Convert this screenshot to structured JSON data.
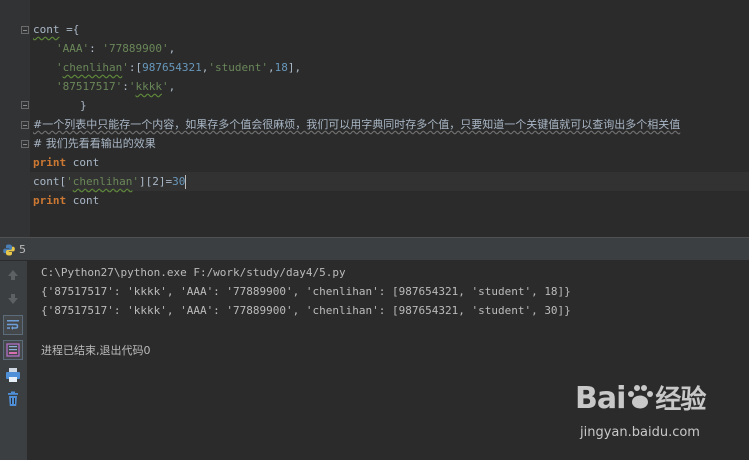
{
  "editor": {
    "lines": [
      {
        "t1": "cont",
        "t2": " ={"
      },
      {
        "s1": "'AAA'",
        "p1": ": ",
        "s2": "'77889900'",
        "p2": ","
      },
      {
        "s1": "'",
        "w1": "chenlihan",
        "s1b": "'",
        "p1": ":[",
        "n1": "987654321",
        "p2": ",",
        "s2": "'student'",
        "p3": ",",
        "n2": "18",
        "p4": "],"
      },
      {
        "s1": "'87517517'",
        "p1": ":",
        "s2": "'",
        "w2": "kkkk",
        "s2b": "'",
        "p2": ","
      },
      {
        "t": "}"
      },
      {
        "c": "#一个列表中只能存一个内容，如果存多个值会很麻烦，我们可以用字典同时存多个值，只要知道一个关键值就可以查询出多个相关值"
      },
      {
        "c": "# 我们先看看输出的效果"
      },
      {
        "kw": "print",
        "rest": " cont"
      },
      {
        "a": "cont[",
        "s1": "'",
        "w": "chenlihan",
        "s1b": "'",
        "b": "][2]=",
        "n": "30"
      },
      {
        "kw": "print",
        "rest": " cont"
      }
    ]
  },
  "run": {
    "tab_label": "5"
  },
  "console": {
    "command": "C:\\Python27\\python.exe F:/work/study/day4/5.py",
    "output1": "{'87517517': 'kkkk', 'AAA': '77889900', 'chenlihan': [987654321, 'student', 18]}",
    "output2": "{'87517517': 'kkkk', 'AAA': '77889900', 'chenlihan': [987654321, 'student', 30]}",
    "exit": "进程已结束,退出代码0"
  },
  "watermark": {
    "brand": "Bai",
    "brand2": "经验",
    "url": "jingyan.baidu.com"
  }
}
